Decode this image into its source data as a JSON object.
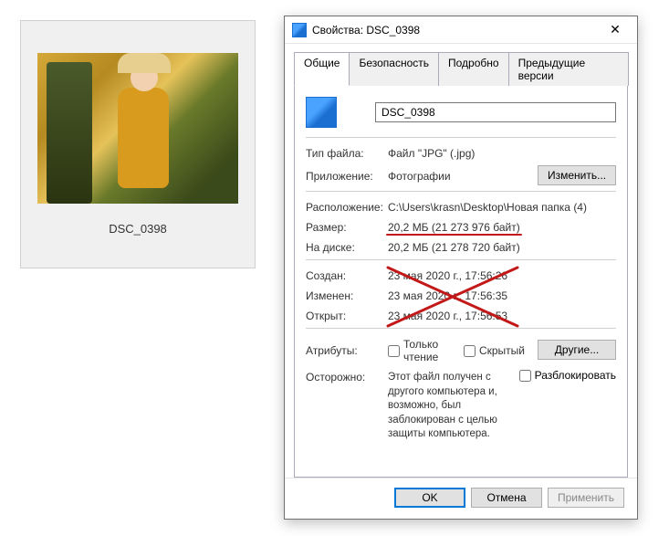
{
  "thumbnail": {
    "caption": "DSC_0398"
  },
  "dialog": {
    "title": "Свойства: DSC_0398",
    "tabs": {
      "general": "Общие",
      "security": "Безопасность",
      "details": "Подробно",
      "previous": "Предыдущие версии"
    },
    "filename": "DSC_0398",
    "labels": {
      "filetype": "Тип файла:",
      "app": "Приложение:",
      "location": "Расположение:",
      "size": "Размер:",
      "sizeondisk": "На диске:",
      "created": "Создан:",
      "modified": "Изменен:",
      "accessed": "Открыт:",
      "attributes": "Атрибуты:",
      "warning": "Осторожно:"
    },
    "values": {
      "filetype": "Файл \"JPG\" (.jpg)",
      "app": "Фотографии",
      "location": "C:\\Users\\krasn\\Desktop\\Новая папка (4)",
      "size": "20,2 МБ (21 273 976 байт)",
      "sizeondisk": "20,2 МБ (21 278 720 байт)",
      "created": "23 мая 2020 г., 17:56:26",
      "modified": "23 мая 2020 г., 17:56:35",
      "accessed": "23 мая 2020 г., 17:56:53"
    },
    "buttons": {
      "change": "Изменить...",
      "other": "Другие...",
      "ok": "OK",
      "cancel": "Отмена",
      "apply": "Применить"
    },
    "checkboxes": {
      "readonly": "Только чтение",
      "hidden": "Скрытый",
      "unblock": "Разблокировать"
    },
    "warning_text": "Этот файл получен с другого компьютера и, возможно, был заблокирован с целью защиты компьютера."
  }
}
